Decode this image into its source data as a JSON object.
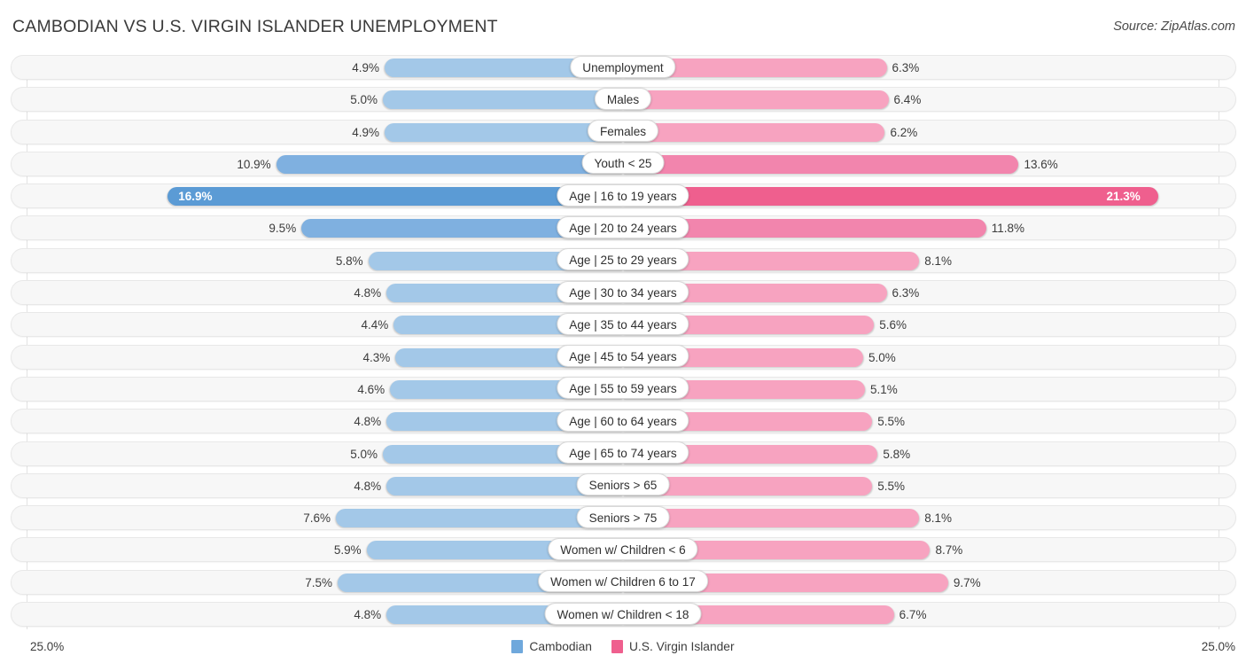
{
  "header": {
    "title": "CAMBODIAN VS U.S. VIRGIN ISLANDER UNEMPLOYMENT",
    "source": "Source: ZipAtlas.com"
  },
  "axis": {
    "left_max_label": "25.0%",
    "right_max_label": "25.0%"
  },
  "legend": {
    "items": [
      {
        "label": "Cambodian",
        "color": "#6fa8dc"
      },
      {
        "label": "U.S. Virgin Islander",
        "color": "#ef5f8e"
      }
    ]
  },
  "colors": {
    "blue_light": "#a3c8e8",
    "blue_mid": "#7fb0e0",
    "blue_strong": "#5b9bd5",
    "pink_light": "#f7a3c0",
    "pink_mid": "#f285ad",
    "pink_strong": "#ef5f8e",
    "track_bg": "#f7f7f7",
    "track_border": "#e8e8e8",
    "gridline": "#e2e2e2"
  },
  "chart_data": {
    "type": "bar",
    "subtype": "diverging-butterfly",
    "title": "CAMBODIAN VS U.S. VIRGIN ISLANDER UNEMPLOYMENT",
    "xlabel": "",
    "ylabel": "",
    "xlim": [
      25.0,
      25.0
    ],
    "unit": "%",
    "grid": true,
    "legend_position": "bottom-center",
    "categories": [
      "Unemployment",
      "Males",
      "Females",
      "Youth < 25",
      "Age | 16 to 19 years",
      "Age | 20 to 24 years",
      "Age | 25 to 29 years",
      "Age | 30 to 34 years",
      "Age | 35 to 44 years",
      "Age | 45 to 54 years",
      "Age | 55 to 59 years",
      "Age | 60 to 64 years",
      "Age | 65 to 74 years",
      "Seniors > 65",
      "Seniors > 75",
      "Women w/ Children < 6",
      "Women w/ Children 6 to 17",
      "Women w/ Children < 18"
    ],
    "series": [
      {
        "name": "Cambodian",
        "side": "left",
        "values": [
          4.9,
          5.0,
          4.9,
          10.9,
          16.9,
          9.5,
          5.8,
          4.8,
          4.4,
          4.3,
          4.6,
          4.8,
          5.0,
          4.8,
          7.6,
          5.9,
          7.5,
          4.8
        ],
        "labels": [
          "4.9%",
          "5.0%",
          "4.9%",
          "10.9%",
          "16.9%",
          "9.5%",
          "5.8%",
          "4.8%",
          "4.4%",
          "4.3%",
          "4.6%",
          "4.8%",
          "5.0%",
          "4.8%",
          "7.6%",
          "5.9%",
          "7.5%",
          "4.8%"
        ]
      },
      {
        "name": "U.S. Virgin Islander",
        "side": "right",
        "values": [
          6.3,
          6.4,
          6.2,
          13.6,
          21.3,
          11.8,
          8.1,
          6.3,
          5.6,
          5.0,
          5.1,
          5.5,
          5.8,
          5.5,
          8.1,
          8.7,
          9.7,
          6.7
        ],
        "labels": [
          "6.3%",
          "6.4%",
          "6.2%",
          "13.6%",
          "21.3%",
          "11.8%",
          "8.1%",
          "6.3%",
          "5.6%",
          "5.0%",
          "5.1%",
          "5.5%",
          "5.8%",
          "5.5%",
          "8.1%",
          "8.7%",
          "9.7%",
          "6.7%"
        ]
      }
    ]
  },
  "rows": [
    {
      "label": "Unemployment",
      "left": "4.9%",
      "right": "6.3%",
      "lv": 4.9,
      "rv": 6.3,
      "intensity": "light"
    },
    {
      "label": "Males",
      "left": "5.0%",
      "right": "6.4%",
      "lv": 5.0,
      "rv": 6.4,
      "intensity": "light"
    },
    {
      "label": "Females",
      "left": "4.9%",
      "right": "6.2%",
      "lv": 4.9,
      "rv": 6.2,
      "intensity": "light"
    },
    {
      "label": "Youth < 25",
      "left": "10.9%",
      "right": "13.6%",
      "lv": 10.9,
      "rv": 13.6,
      "intensity": "mid"
    },
    {
      "label": "Age | 16 to 19 years",
      "left": "16.9%",
      "right": "21.3%",
      "lv": 16.9,
      "rv": 21.3,
      "intensity": "strong"
    },
    {
      "label": "Age | 20 to 24 years",
      "left": "9.5%",
      "right": "11.8%",
      "lv": 9.5,
      "rv": 11.8,
      "intensity": "mid"
    },
    {
      "label": "Age | 25 to 29 years",
      "left": "5.8%",
      "right": "8.1%",
      "lv": 5.8,
      "rv": 8.1,
      "intensity": "light"
    },
    {
      "label": "Age | 30 to 34 years",
      "left": "4.8%",
      "right": "6.3%",
      "lv": 4.8,
      "rv": 6.3,
      "intensity": "light"
    },
    {
      "label": "Age | 35 to 44 years",
      "left": "4.4%",
      "right": "5.6%",
      "lv": 4.4,
      "rv": 5.6,
      "intensity": "light"
    },
    {
      "label": "Age | 45 to 54 years",
      "left": "4.3%",
      "right": "5.0%",
      "lv": 4.3,
      "rv": 5.0,
      "intensity": "light"
    },
    {
      "label": "Age | 55 to 59 years",
      "left": "4.6%",
      "right": "5.1%",
      "lv": 4.6,
      "rv": 5.1,
      "intensity": "light"
    },
    {
      "label": "Age | 60 to 64 years",
      "left": "4.8%",
      "right": "5.5%",
      "lv": 4.8,
      "rv": 5.5,
      "intensity": "light"
    },
    {
      "label": "Age | 65 to 74 years",
      "left": "5.0%",
      "right": "5.8%",
      "lv": 5.0,
      "rv": 5.8,
      "intensity": "light"
    },
    {
      "label": "Seniors > 65",
      "left": "4.8%",
      "right": "5.5%",
      "lv": 4.8,
      "rv": 5.5,
      "intensity": "light"
    },
    {
      "label": "Seniors > 75",
      "left": "7.6%",
      "right": "8.1%",
      "lv": 7.6,
      "rv": 8.1,
      "intensity": "light"
    },
    {
      "label": "Women w/ Children < 6",
      "left": "5.9%",
      "right": "8.7%",
      "lv": 5.9,
      "rv": 8.7,
      "intensity": "light"
    },
    {
      "label": "Women w/ Children 6 to 17",
      "left": "7.5%",
      "right": "9.7%",
      "lv": 7.5,
      "rv": 9.7,
      "intensity": "light"
    },
    {
      "label": "Women w/ Children < 18",
      "left": "4.8%",
      "right": "6.7%",
      "lv": 4.8,
      "rv": 6.7,
      "intensity": "light"
    }
  ]
}
